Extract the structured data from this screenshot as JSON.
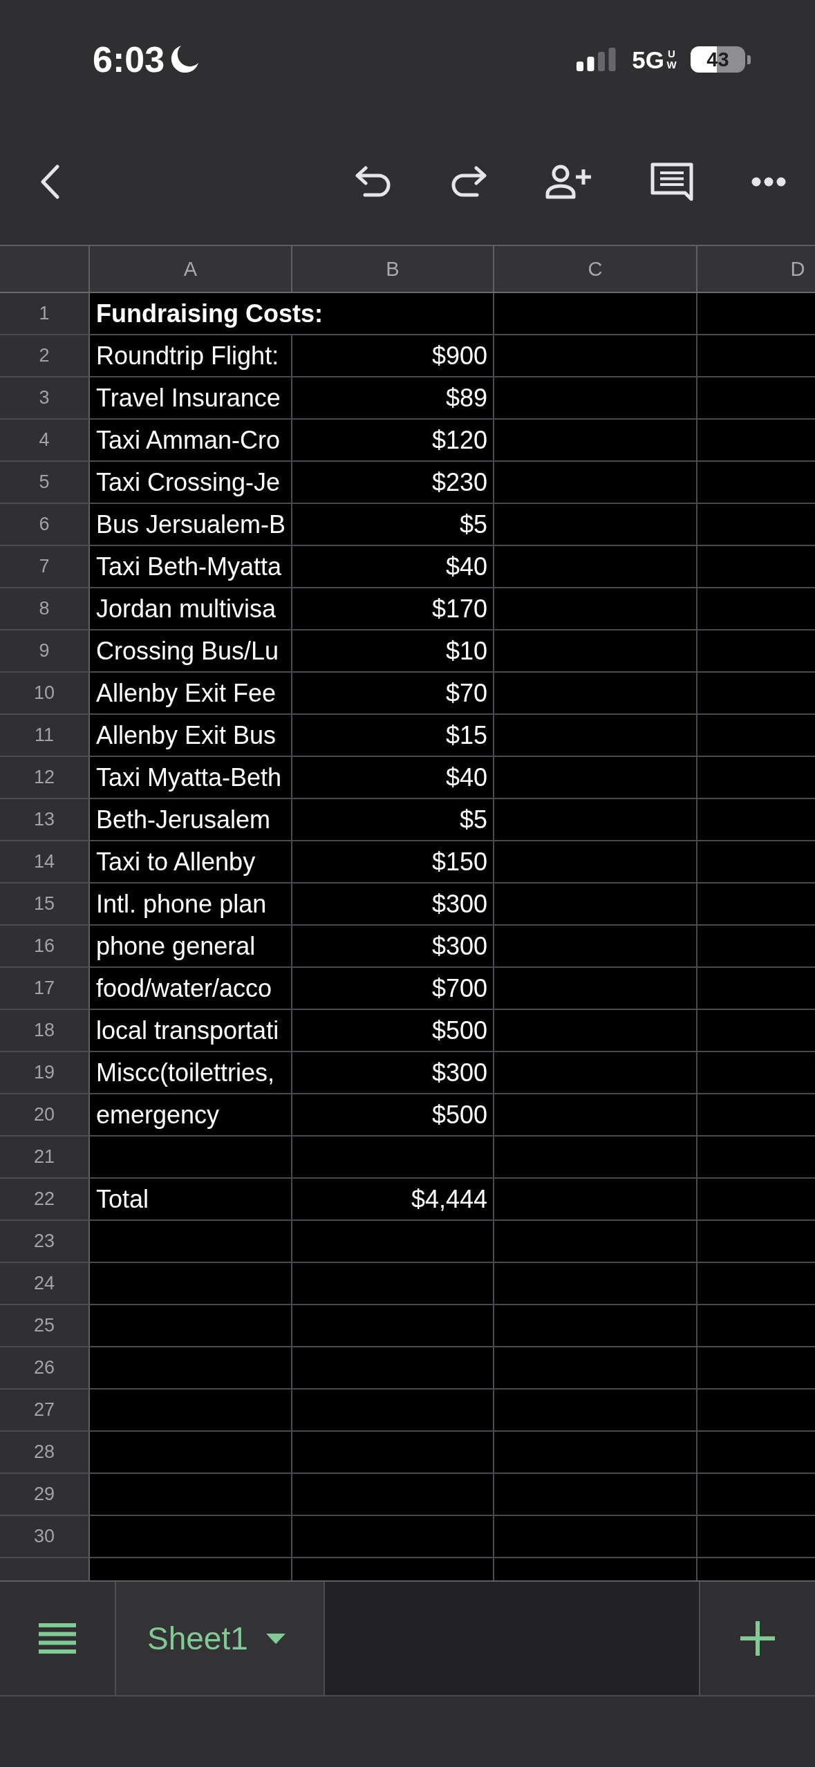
{
  "status_bar": {
    "time": "6:03",
    "network": "5G",
    "network_badge": "UW",
    "battery": "43"
  },
  "columns": [
    "A",
    "B",
    "C",
    "D"
  ],
  "rows": [
    {
      "number": "1",
      "kind": "title",
      "label": "Fundraising Costs:"
    },
    {
      "number": "2",
      "kind": "item",
      "label": "Roundtrip Flight:",
      "amount": "$900"
    },
    {
      "number": "3",
      "kind": "item",
      "label": "Travel Insurance",
      "amount": "$89"
    },
    {
      "number": "4",
      "kind": "item",
      "label": "Taxi Amman-Cro",
      "amount": "$120"
    },
    {
      "number": "5",
      "kind": "item",
      "label": "Taxi Crossing-Je",
      "amount": "$230"
    },
    {
      "number": "6",
      "kind": "item",
      "label": "Bus Jersualem-B",
      "amount": "$5"
    },
    {
      "number": "7",
      "kind": "item",
      "label": "Taxi Beth-Myatta",
      "amount": "$40"
    },
    {
      "number": "8",
      "kind": "item",
      "label": "Jordan multivisa",
      "amount": "$170"
    },
    {
      "number": "9",
      "kind": "item",
      "label": "Crossing Bus/Lu",
      "amount": "$10"
    },
    {
      "number": "10",
      "kind": "item",
      "label": "Allenby Exit Fee",
      "amount": "$70"
    },
    {
      "number": "11",
      "kind": "item",
      "label": "Allenby Exit Bus",
      "amount": "$15"
    },
    {
      "number": "12",
      "kind": "item",
      "label": "Taxi Myatta-Beth",
      "amount": "$40"
    },
    {
      "number": "13",
      "kind": "item",
      "label": "Beth-Jerusalem",
      "amount": "$5"
    },
    {
      "number": "14",
      "kind": "item",
      "label": "Taxi to Allenby",
      "amount": "$150"
    },
    {
      "number": "15",
      "kind": "item",
      "label": "Intl. phone plan",
      "amount": "$300"
    },
    {
      "number": "16",
      "kind": "item",
      "label": "phone general",
      "amount": "$300"
    },
    {
      "number": "17",
      "kind": "item",
      "label": "food/water/acco",
      "amount": "$700"
    },
    {
      "number": "18",
      "kind": "item",
      "label": "local transportati",
      "amount": "$500"
    },
    {
      "number": "19",
      "kind": "item",
      "label": "Miscc(toilettries,",
      "amount": "$300"
    },
    {
      "number": "20",
      "kind": "item",
      "label": "emergency",
      "amount": "$500"
    },
    {
      "number": "21",
      "kind": "item"
    },
    {
      "number": "22",
      "kind": "item",
      "label": "Total",
      "amount": "$4,444"
    },
    {
      "number": "23",
      "kind": "item"
    },
    {
      "number": "24",
      "kind": "item"
    },
    {
      "number": "25",
      "kind": "item"
    },
    {
      "number": "26",
      "kind": "item"
    },
    {
      "number": "27",
      "kind": "item"
    },
    {
      "number": "28",
      "kind": "item"
    },
    {
      "number": "29",
      "kind": "item"
    },
    {
      "number": "30",
      "kind": "item"
    }
  ],
  "sheet_tabs": [
    {
      "label": "Sheet1",
      "selected": true
    }
  ]
}
